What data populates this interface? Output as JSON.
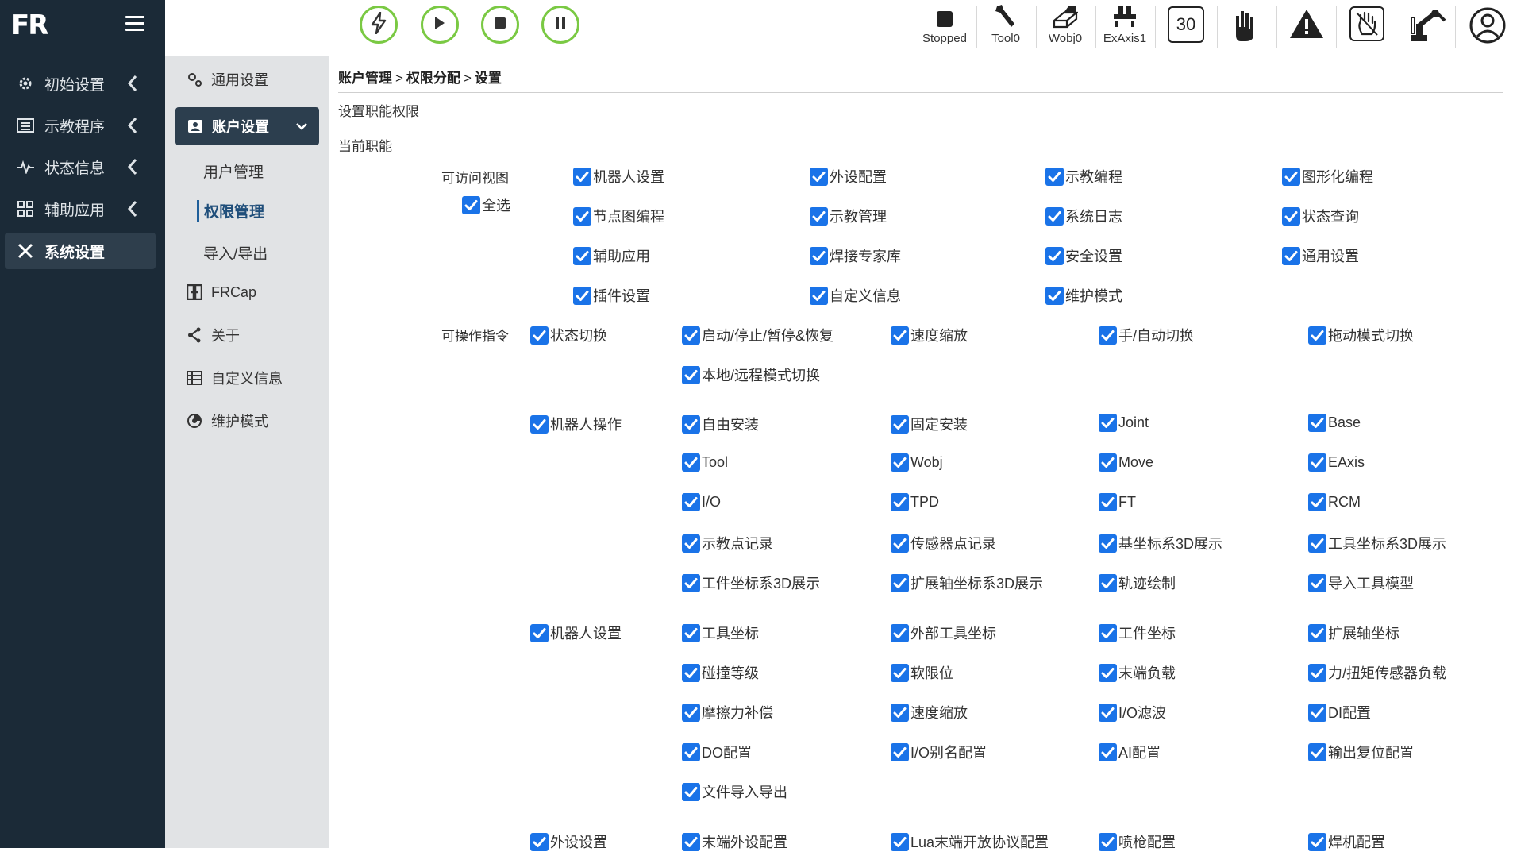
{
  "logo": "FR",
  "leftnav": {
    "items": [
      {
        "label": "初始设置",
        "icon": "gear-icon"
      },
      {
        "label": "示教程序",
        "icon": "list-icon"
      },
      {
        "label": "状态信息",
        "icon": "pulse-icon"
      },
      {
        "label": "辅助应用",
        "icon": "grid-icon"
      },
      {
        "label": "系统设置",
        "icon": "tools-icon"
      }
    ]
  },
  "subnav": {
    "general": "通用设置",
    "account": "账户设置",
    "user_mgmt": "用户管理",
    "permission": "权限管理",
    "import_export": "导入/导出",
    "frcap": "FRCap",
    "about": "关于",
    "custom_info": "自定义信息",
    "maintenance": "维护模式"
  },
  "toolbar": {
    "status": "Stopped",
    "tool": "Tool0",
    "wobj": "Wobj0",
    "exaxis": "ExAxis1",
    "speed": "30"
  },
  "breadcrumb": {
    "a": "账户管理",
    "b": "权限分配",
    "c": "设置",
    "sep": ">"
  },
  "section_title": "设置职能权限",
  "current_role": "当前职能",
  "views": {
    "label": "可访问视图",
    "select_all": "全选",
    "items": [
      "机器人设置",
      "外设配置",
      "示教编程",
      "图形化编程",
      "节点图编程",
      "示教管理",
      "系统日志",
      "状态查询",
      "辅助应用",
      "焊接专家库",
      "安全设置",
      "通用设置",
      "插件设置",
      "自定义信息",
      "维护模式"
    ]
  },
  "commands": {
    "label": "可操作指令",
    "state_switch": "状态切换",
    "state_items": [
      "启动/停止/暂停&恢复",
      "速度缩放",
      "手/自动切换",
      "拖动模式切换",
      "本地/远程模式切换"
    ],
    "robot_op": "机器人操作",
    "robot_op_items": [
      "自由安装",
      "固定安装",
      "Joint",
      "Base",
      "Tool",
      "Wobj",
      "Move",
      "EAxis",
      "I/O",
      "TPD",
      "FT",
      "RCM",
      "示教点记录",
      "传感器点记录",
      "基坐标系3D展示",
      "工具坐标系3D展示",
      "工件坐标系3D展示",
      "扩展轴坐标系3D展示",
      "轨迹绘制",
      "导入工具模型"
    ],
    "robot_set": "机器人设置",
    "robot_set_items": [
      "工具坐标",
      "外部工具坐标",
      "工件坐标",
      "扩展轴坐标",
      "碰撞等级",
      "软限位",
      "末端负载",
      "力/扭矩传感器负载",
      "摩擦力补偿",
      "速度缩放",
      "I/O滤波",
      "DI配置",
      "DO配置",
      "I/O别名配置",
      "AI配置",
      "输出复位配置",
      "文件导入导出"
    ],
    "periph": "外设设置",
    "periph_items": [
      "末端外设配置",
      "Lua末端开放协议配置",
      "喷枪配置",
      "焊机配置"
    ]
  }
}
